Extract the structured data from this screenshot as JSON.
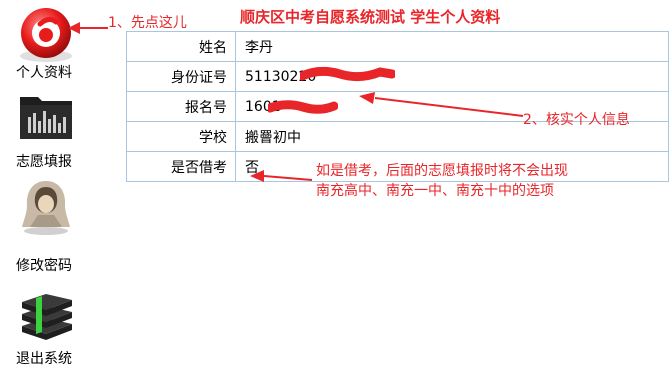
{
  "title": "顺庆区中考自愿系统测试 学生个人资料",
  "sidebar": {
    "items": [
      {
        "label": "个人资料",
        "icon": "red-circle-logo-icon"
      },
      {
        "label": "志愿填报",
        "icon": "equalizer-folder-icon"
      },
      {
        "label": "修改密码",
        "icon": "hooded-user-icon"
      },
      {
        "label": "退出系统",
        "icon": "book-stack-icon"
      }
    ]
  },
  "table": {
    "rows": [
      {
        "label": "姓名",
        "value": "李丹"
      },
      {
        "label": "身份证号",
        "value": "51130220"
      },
      {
        "label": "报名号",
        "value": "1601"
      },
      {
        "label": "学校",
        "value": "搬罾初中"
      },
      {
        "label": "是否借考",
        "value": "否"
      }
    ]
  },
  "annotations": {
    "step1": "1、先点这儿",
    "step2": "2、核实个人信息",
    "note_line1": "如是借考，后面的志愿填报时将不会出现",
    "note_line2": "南充高中、南充一中、南充十中的选项"
  },
  "colors": {
    "accent_red": "#e8262a",
    "table_border": "#a9c6de"
  }
}
